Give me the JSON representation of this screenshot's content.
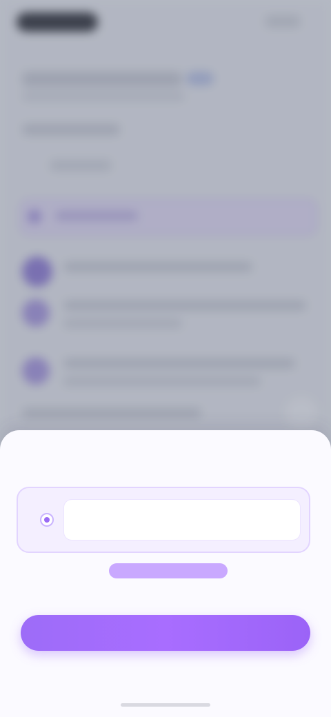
{
  "background": {
    "obscured": true
  },
  "sheet": {
    "title": "",
    "option": {
      "label": "",
      "value": "",
      "selected": true
    },
    "secondary_text": "",
    "link_label": "",
    "note": "",
    "primary_button_label": "",
    "footnote": ""
  },
  "colors": {
    "accent": "#9b63f7",
    "accent_soft": "#c9a8ff",
    "sheet_background": "#fbfaff",
    "scrim": "#5a6076"
  }
}
